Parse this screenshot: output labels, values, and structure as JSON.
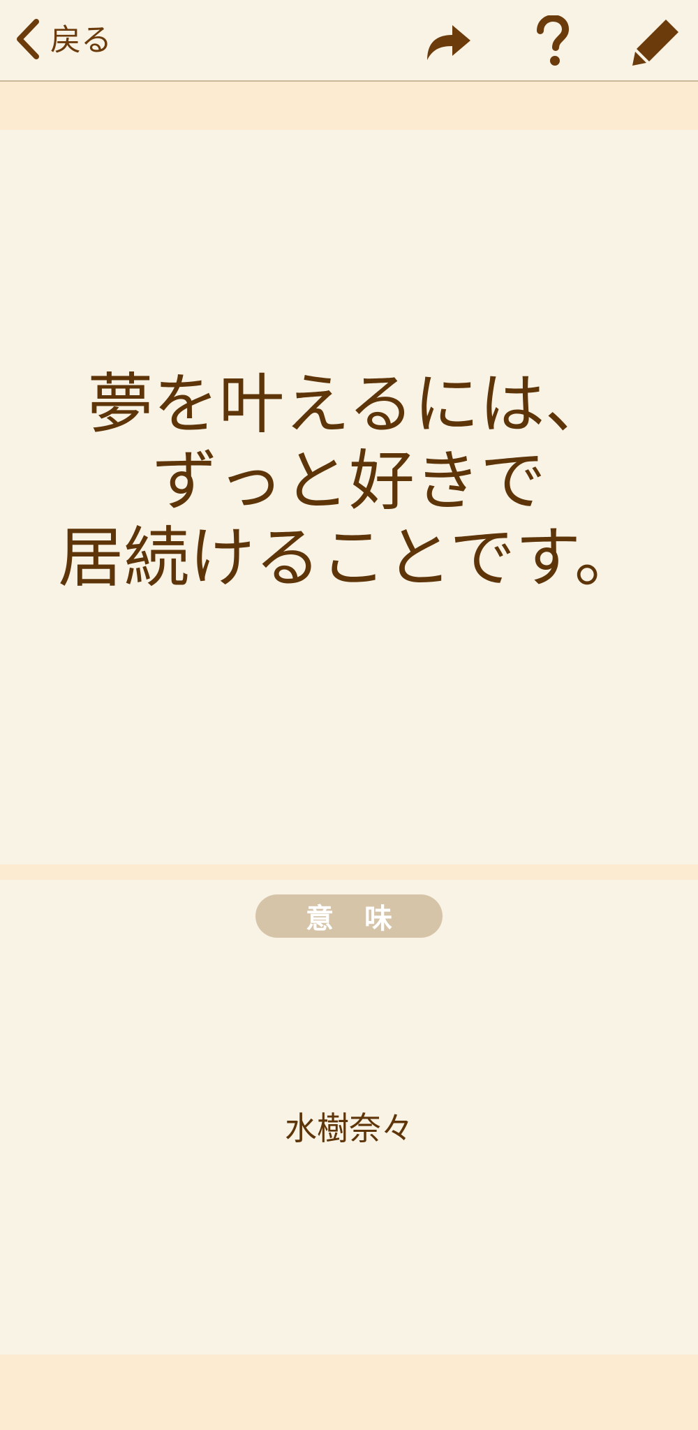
{
  "header": {
    "back_label": "戻る",
    "icons": {
      "back": "chevron-left-icon",
      "share": "share-arrow-icon",
      "help": "question-icon",
      "edit": "pencil-icon"
    }
  },
  "quote": {
    "lines": [
      "夢を叶えるには、",
      "ずっと好きで",
      "居続けることです。"
    ]
  },
  "meaning_button": {
    "label": "意味"
  },
  "author": {
    "name": "水樹奈々"
  },
  "colors": {
    "background": "#f9f3e5",
    "band": "#fdebd1",
    "text": "#5e3409",
    "button": "#d6c4a9"
  }
}
